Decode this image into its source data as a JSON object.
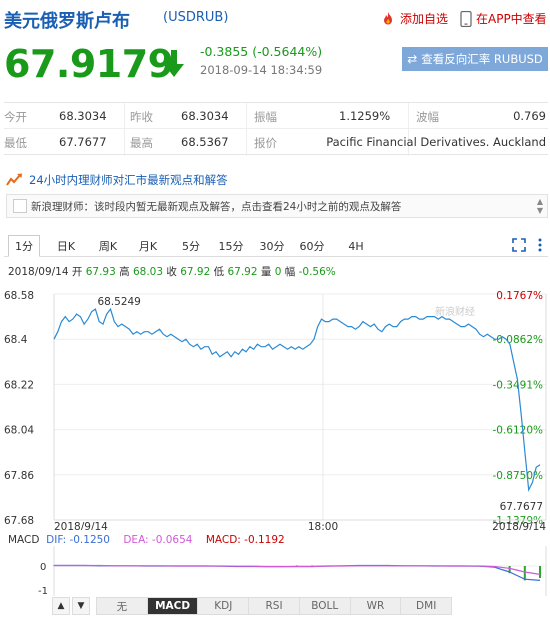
{
  "header": {
    "name": "美元俄罗斯卢布",
    "code": "(USDRUB)",
    "add_watch": "添加自选",
    "open_app": "在APP中查看"
  },
  "quote": {
    "price": "67.9179",
    "change": "-0.3855 (-0.5644%)",
    "timestamp": "2018-09-14 18:34:59",
    "reverse_btn": "查看反向汇率 RUBUSD",
    "reverse_icon": "swap-arrows-icon"
  },
  "stats": {
    "open_label": "今开",
    "open": "68.3034",
    "prev_close_label": "昨收",
    "prev_close": "68.3034",
    "amplitude_label": "振幅",
    "amplitude": "1.1259%",
    "volatility_label": "波幅",
    "volatility": "0.769",
    "low_label": "最低",
    "low": "67.7677",
    "high_label": "最高",
    "high": "68.5367",
    "quote_src_label": "报价",
    "quote_src": "Pacific Financial Derivatives. Auckland"
  },
  "expert": {
    "title": "24小时内理财师对汇市最新观点和解答",
    "message": "新浪理财师：该时段内暂无最新观点及解答，点击查看24小时之前的观点及解答"
  },
  "tabs": [
    "1分",
    "日K",
    "周K",
    "月K",
    "5分",
    "15分",
    "30分",
    "60分",
    "4H"
  ],
  "ohlc": {
    "date": "2018/09/14",
    "open_l": "开",
    "open": "67.93",
    "high_l": "高",
    "high": "68.03",
    "close_l": "收",
    "close": "67.92",
    "low_l": "低",
    "low": "67.92",
    "vol_l": "量",
    "vol": "0",
    "amp_l": "幅",
    "amp": "-0.56%"
  },
  "chart_data": {
    "type": "line",
    "y_ticks_left": [
      "68.58",
      "68.4",
      "68.22",
      "68.04",
      "67.86",
      "67.68"
    ],
    "y_ticks_right": [
      "0.1767%",
      "-0.0862%",
      "-0.3491%",
      "-0.6120%",
      "-0.8750%",
      "-1.1379%"
    ],
    "x_ticks": [
      "2018/9/14",
      "18:00",
      "2018/9/14"
    ],
    "ylim": [
      67.68,
      68.58
    ],
    "annotation_high": "68.5249",
    "annotation_low": "67.7677",
    "watermark": "新浪财经",
    "values": [
      68.4,
      68.43,
      68.47,
      68.49,
      68.47,
      68.48,
      68.5,
      68.49,
      68.46,
      68.48,
      68.51,
      68.52,
      68.47,
      68.46,
      68.5,
      68.52,
      68.47,
      68.45,
      68.46,
      68.45,
      68.44,
      68.42,
      68.43,
      68.42,
      68.43,
      68.43,
      68.42,
      68.43,
      68.44,
      68.42,
      68.41,
      68.42,
      68.41,
      68.4,
      68.39,
      68.4,
      68.38,
      68.37,
      68.38,
      68.36,
      68.37,
      68.37,
      68.34,
      68.35,
      68.33,
      68.34,
      68.35,
      68.33,
      68.35,
      68.34,
      68.36,
      68.35,
      68.37,
      68.36,
      68.38,
      68.37,
      68.37,
      68.38,
      68.36,
      68.37,
      68.38,
      68.37,
      68.36,
      68.37,
      68.36,
      68.37,
      68.36,
      68.37,
      68.38,
      68.4,
      68.45,
      68.48,
      68.47,
      68.47,
      68.48,
      68.48,
      68.47,
      68.46,
      68.45,
      68.45,
      68.44,
      68.45,
      68.47,
      68.46,
      68.45,
      68.46,
      68.44,
      68.43,
      68.45,
      68.46,
      68.45,
      68.45,
      68.47,
      68.48,
      68.48,
      68.49,
      68.49,
      68.48,
      68.48,
      68.49,
      68.49,
      68.49,
      68.48,
      68.49,
      68.48,
      68.48,
      68.47,
      68.46,
      68.45,
      68.45,
      68.46,
      68.45,
      68.44,
      68.42,
      68.41,
      68.42,
      68.41,
      68.4,
      68.4,
      68.41,
      68.4,
      68.38,
      68.31,
      68.24,
      68.1,
      67.95,
      67.8,
      67.83,
      67.89,
      67.9
    ]
  },
  "macd": {
    "label": "MACD",
    "dif": "DIF: -0.1250",
    "dea": "DEA: -0.0654",
    "macd": "MACD: -0.1192",
    "y_ticks": [
      "0",
      "-1"
    ],
    "dif_values": [
      0.02,
      0.02,
      0.02,
      0.01,
      0.01,
      0.01,
      0.0,
      0.0,
      0.0,
      0.0,
      0.0,
      -0.01,
      -0.02,
      -0.02,
      -0.03,
      -0.03,
      -0.02,
      -0.02,
      0.0,
      0.01,
      0.02,
      0.02,
      0.02,
      0.01,
      0.01,
      0.0,
      0.0,
      0.0,
      -0.01,
      -0.05,
      -0.25,
      -0.55,
      -0.6
    ],
    "dea_values": [
      0.02,
      0.02,
      0.02,
      0.02,
      0.01,
      0.01,
      0.01,
      0.01,
      0.0,
      0.0,
      0.0,
      0.0,
      -0.01,
      -0.01,
      -0.02,
      -0.02,
      -0.02,
      -0.02,
      -0.01,
      0.0,
      0.01,
      0.01,
      0.01,
      0.01,
      0.01,
      0.01,
      0.0,
      0.0,
      0.0,
      -0.02,
      -0.1,
      -0.25,
      -0.35
    ]
  },
  "indicator_tabs": [
    "无",
    "MACD",
    "KDJ",
    "RSI",
    "BOLL",
    "WR",
    "DMI"
  ],
  "colors": {
    "price_green": "#1a9a1a",
    "line_blue": "#2b8ad4",
    "dif_blue": "#3a6ed6",
    "dea_pink": "#d05ad6",
    "bar_red": "#e14040",
    "bar_green": "#2aa52a"
  }
}
